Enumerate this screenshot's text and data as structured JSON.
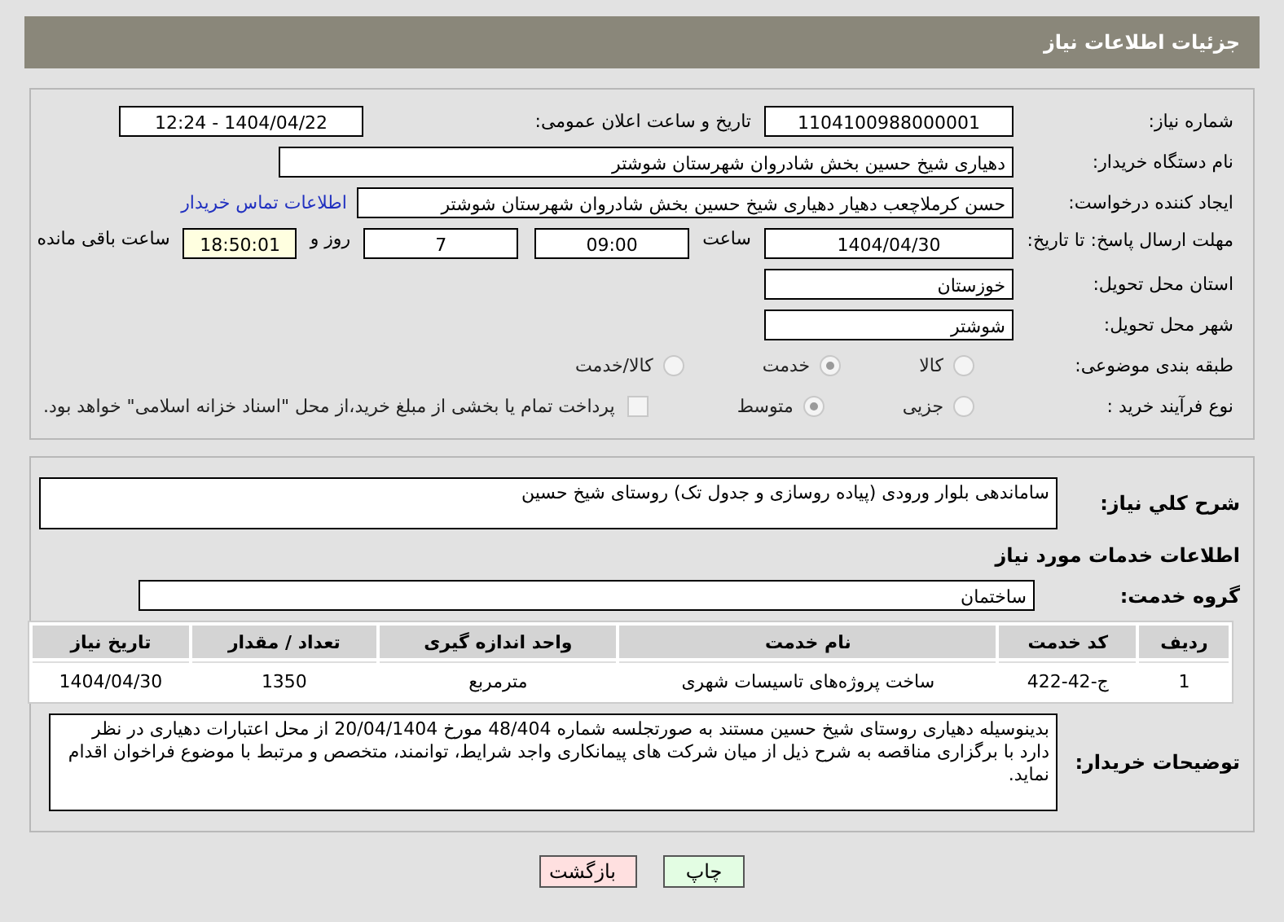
{
  "header": {
    "title": "جزئیات اطلاعات نیاز"
  },
  "need_number": {
    "label": "شماره نیاز:",
    "value": "1104100988000001"
  },
  "announce": {
    "label": "تاریخ و ساعت اعلان عمومی:",
    "value": "1404/04/22 - 12:24"
  },
  "buyer_org": {
    "label": "نام دستگاه خریدار:",
    "value": "دهیاری شیخ حسین بخش شادروان شهرستان شوشتر"
  },
  "creator": {
    "label": "ایجاد کننده درخواست:",
    "value": "حسن کرملاچعب دهیار دهیاری شیخ حسین بخش شادروان شهرستان شوشتر",
    "link": "اطلاعات تماس خریدار"
  },
  "deadline": {
    "label": "مهلت ارسال پاسخ: تا تاریخ:",
    "date": "1404/04/30",
    "time_label": "ساعت",
    "time": "09:00",
    "days": "7",
    "days_label": "روز و",
    "remaining": "18:50:01",
    "remaining_label": "ساعت باقی مانده"
  },
  "province": {
    "label": "استان محل تحویل:",
    "value": "خوزستان"
  },
  "city": {
    "label": "شهر محل تحویل:",
    "value": "شوشتر"
  },
  "category": {
    "label": "طبقه بندی موضوعی:",
    "options": [
      {
        "label": "کالا",
        "selected": false
      },
      {
        "label": "خدمت",
        "selected": true
      },
      {
        "label": "کالا/خدمت",
        "selected": false
      }
    ]
  },
  "purchase_type": {
    "label": "نوع فرآیند خرید :",
    "options": [
      {
        "label": "جزیی",
        "selected": false
      },
      {
        "label": "متوسط",
        "selected": true
      }
    ],
    "payment_note": {
      "text": "پرداخت تمام یا بخشی از مبلغ خرید،از محل \"اسناد خزانه اسلامی\" خواهد بود.",
      "checked": false
    }
  },
  "description": {
    "label": "شرح کلي نیاز:",
    "value": "ساماندهی بلوار ورودی (پیاده روسازی و جدول تک) روستای شیخ حسین"
  },
  "services_title": "اطلاعات خدمات مورد نیاز",
  "service_group": {
    "label": "گروه خدمت:",
    "value": "ساختمان"
  },
  "table": {
    "columns": [
      "ردیف",
      "کد خدمت",
      "نام خدمت",
      "واحد اندازه گیری",
      "تعداد / مقدار",
      "تاریخ نیاز"
    ],
    "rows": [
      [
        "1",
        "ج-42-422",
        "ساخت پروژه‌های تاسیسات شهری",
        "مترمربع",
        "1350",
        "1404/04/30"
      ]
    ]
  },
  "buyer_notes": {
    "label": "توضیحات خریدار:",
    "value": "بدینوسیله دهیاری روستای شیخ حسین مستند به صورتجلسه شماره 48/404 مورخ 20/04/1404 از محل اعتبارات دهیاری در نظر دارد با برگزاری مناقصه به شرح ذیل از میان شرکت های پیمانکاری واجد شرایط، توانمند، متخصص و مرتبط با موضوع فراخوان اقدام نماید."
  },
  "buttons": [
    {
      "label": "چاپ",
      "kind": "print"
    },
    {
      "label": "بازگشت",
      "kind": "back"
    }
  ]
}
